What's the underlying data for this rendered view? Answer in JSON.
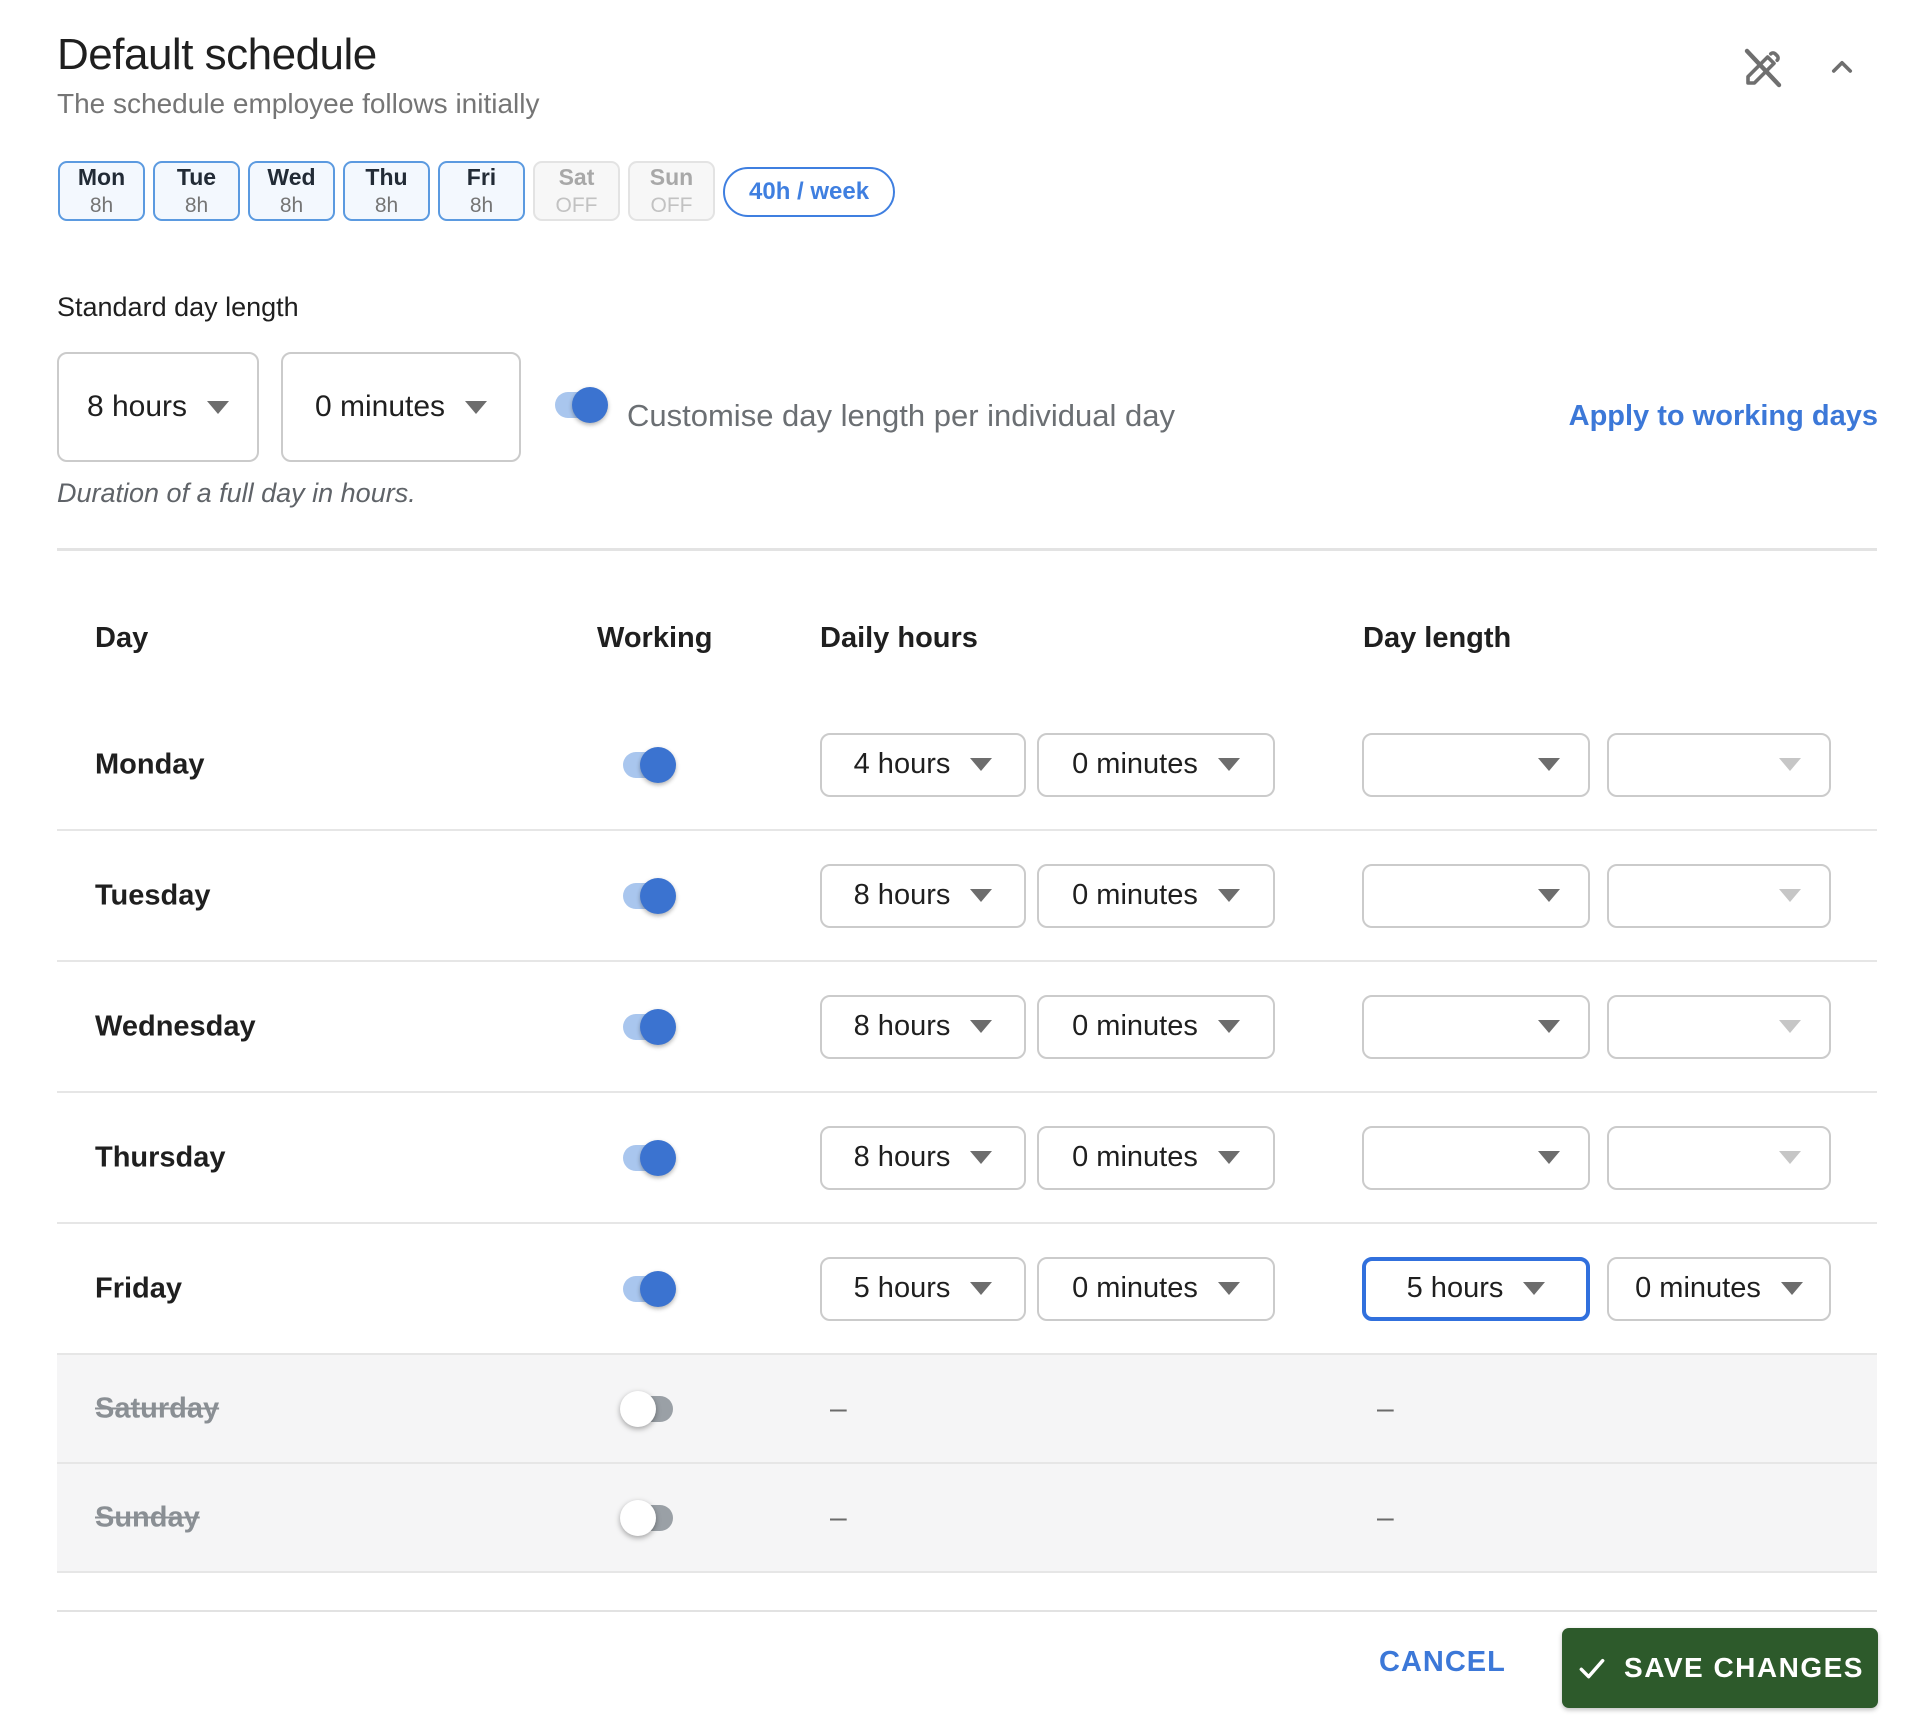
{
  "header": {
    "title": "Default schedule",
    "subtitle": "The schedule employee follows initially",
    "week_total": "40h / week",
    "day_chips": [
      {
        "day": "Mon",
        "value": "8h",
        "active": true
      },
      {
        "day": "Tue",
        "value": "8h",
        "active": true
      },
      {
        "day": "Wed",
        "value": "8h",
        "active": true
      },
      {
        "day": "Thu",
        "value": "8h",
        "active": true
      },
      {
        "day": "Fri",
        "value": "8h",
        "active": true
      },
      {
        "day": "Sat",
        "value": "OFF",
        "active": false
      },
      {
        "day": "Sun",
        "value": "OFF",
        "active": false
      }
    ]
  },
  "standard": {
    "label": "Standard day length",
    "hours_value": "8 hours",
    "minutes_value": "0 minutes",
    "customise_label": "Customise day length per individual day",
    "customise_on": true,
    "apply_link": "Apply to working days",
    "note": "Duration of a full day in hours."
  },
  "table": {
    "columns": {
      "day": "Day",
      "working": "Working",
      "daily_hours": "Daily hours",
      "day_length": "Day length"
    },
    "dash": "–",
    "rows": [
      {
        "day": "Monday",
        "working": true,
        "daily_hours": "4 hours",
        "daily_minutes": "0 minutes",
        "day_length_hours": "",
        "day_length_minutes": "",
        "day_length_focused": false
      },
      {
        "day": "Tuesday",
        "working": true,
        "daily_hours": "8 hours",
        "daily_minutes": "0 minutes",
        "day_length_hours": "",
        "day_length_minutes": "",
        "day_length_focused": false
      },
      {
        "day": "Wednesday",
        "working": true,
        "daily_hours": "8 hours",
        "daily_minutes": "0 minutes",
        "day_length_hours": "",
        "day_length_minutes": "",
        "day_length_focused": false
      },
      {
        "day": "Thursday",
        "working": true,
        "daily_hours": "8 hours",
        "daily_minutes": "0 minutes",
        "day_length_hours": "",
        "day_length_minutes": "",
        "day_length_focused": false
      },
      {
        "day": "Friday",
        "working": true,
        "daily_hours": "5 hours",
        "daily_minutes": "0 minutes",
        "day_length_hours": "5 hours",
        "day_length_minutes": "0 minutes",
        "day_length_focused": true
      },
      {
        "day": "Saturday",
        "working": false
      },
      {
        "day": "Sunday",
        "working": false
      }
    ]
  },
  "footer": {
    "cancel": "CANCEL",
    "save": "SAVE CHANGES"
  },
  "colors": {
    "accent_blue": "#3c78d8",
    "chip_border_blue": "#5b9ae0",
    "toggle_on_blue": "#3b73d0",
    "focused_border_blue": "#3170dd",
    "save_green": "#2d5a2b",
    "row_off_gray": "#f5f5f6"
  }
}
